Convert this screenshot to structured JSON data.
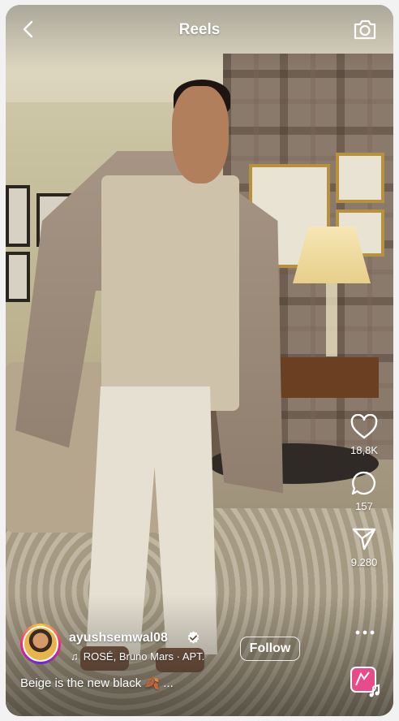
{
  "header": {
    "title": "Reels",
    "back_icon": "chevron-left-icon",
    "camera_icon": "camera-icon"
  },
  "actions": {
    "like": {
      "icon": "heart-icon",
      "count": "18,8K"
    },
    "comment": {
      "icon": "comment-icon",
      "count": "157"
    },
    "share": {
      "icon": "send-icon",
      "count": "9.280"
    },
    "more_icon": "more-horizontal-icon"
  },
  "post": {
    "username": "ayushsemwal08",
    "verified": true,
    "audio": "ROSÉ, Bruno Mars · APT.",
    "follow_label": "Follow",
    "caption": "Beige is the new black 🍂 ..."
  },
  "colors": {
    "text": "#ffffff",
    "avatar_ring_start": "#f9ce34",
    "avatar_ring_mid": "#ee2a7b",
    "music_thumb": "#e94b8a"
  }
}
